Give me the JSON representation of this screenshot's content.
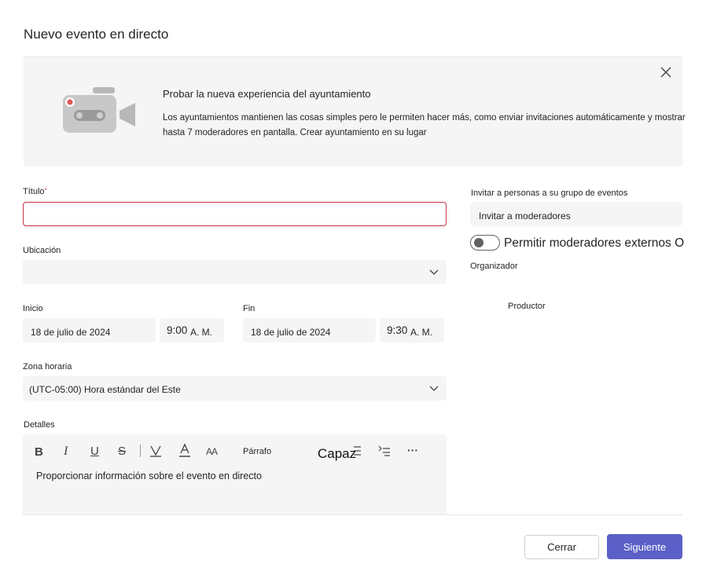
{
  "dialog": {
    "title": "Nuevo evento en directo"
  },
  "banner": {
    "heading": "Probar la nueva experiencia del ayuntamiento",
    "line1": "Los ayuntamientos mantienen las cosas simples pero le permiten hacer más, como enviar invitaciones automáticamente y mostrar",
    "line2": "hasta 7 moderadores en pantalla. Crear ayuntamiento en su lugar"
  },
  "form": {
    "title_label": "Título",
    "title_required_mark": "*",
    "title_value": "",
    "location_label": "Ubicación",
    "location_value": "",
    "start_label": "Inicio",
    "start_date": "18 de julio de 2024",
    "start_time_num": "9:00",
    "start_time_ampm": "A. M.",
    "end_label": "Fin",
    "end_date": "18 de julio de 2024",
    "end_time_num": "9:30",
    "end_time_ampm": "A. M.",
    "timezone_label": "Zona horaria",
    "timezone_value": "(UTC-05:00) Hora estándar del Este",
    "details_label": "Detalles",
    "details_placeholder": "Proporcionar información sobre el evento en directo",
    "toolbar": {
      "bold": "B",
      "italic": "I",
      "underline": "U",
      "strike": "S",
      "font_size": "AA",
      "paragraph": "Párrafo",
      "overlay": "Capaz",
      "more": "···"
    }
  },
  "right_panel": {
    "invite_label": "Invitar a personas a su grupo de eventos",
    "invite_value": "Invitar a moderadores",
    "toggle_label": "Permitir moderadores externos O",
    "toggle_on": false,
    "organizer_label": "Organizador",
    "producer_label": "Productor"
  },
  "footer": {
    "cancel_label": "Cerrar",
    "next_label": "Siguiente"
  },
  "colors": {
    "primary": "#5b5fc7",
    "error_border": "#c4314b",
    "field_bg": "#f5f5f5"
  }
}
